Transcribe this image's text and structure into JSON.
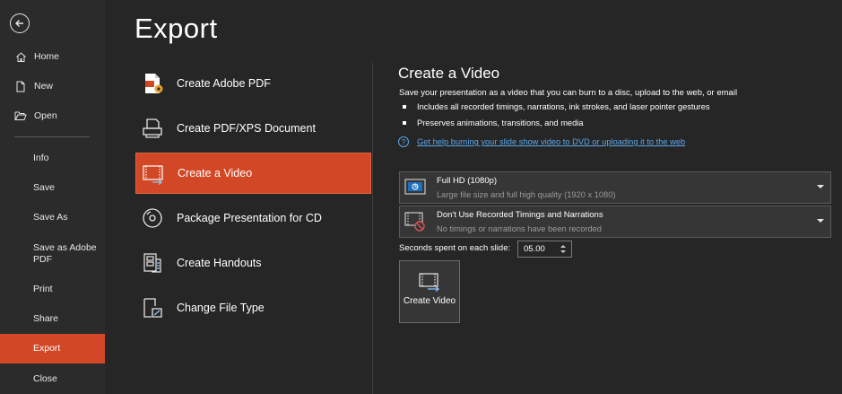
{
  "sidebar": {
    "items": [
      {
        "label": "Home",
        "icon": "home-icon"
      },
      {
        "label": "New",
        "icon": "new-doc-icon"
      },
      {
        "label": "Open",
        "icon": "folder-open-icon"
      },
      {
        "label": "Info"
      },
      {
        "label": "Save"
      },
      {
        "label": "Save As"
      },
      {
        "label": "Save as Adobe PDF"
      },
      {
        "label": "Print"
      },
      {
        "label": "Share"
      },
      {
        "label": "Export",
        "active": true
      },
      {
        "label": "Close"
      }
    ]
  },
  "page": {
    "title": "Export"
  },
  "export_options": [
    {
      "label": "Create Adobe PDF",
      "icon": "adobe-pdf-icon"
    },
    {
      "label": "Create PDF/XPS Document",
      "icon": "pdf-xps-icon"
    },
    {
      "label": "Create a Video",
      "icon": "video-icon",
      "selected": true
    },
    {
      "label": "Package Presentation for CD",
      "icon": "cd-icon"
    },
    {
      "label": "Create Handouts",
      "icon": "handouts-icon"
    },
    {
      "label": "Change File Type",
      "icon": "change-file-type-icon"
    }
  ],
  "pane": {
    "title": "Create a Video",
    "description": "Save your presentation as a video that you can burn to a disc, upload to the web, or email",
    "bullets": [
      "Includes all recorded timings, narrations, ink strokes, and laser pointer gestures",
      "Preserves animations, transitions, and media"
    ],
    "help_link": "Get help burning your slide show video to DVD or uploading it to the web",
    "quality": {
      "main": "Full HD (1080p)",
      "sub": "Large file size and full high quality (1920 x 1080)"
    },
    "timings": {
      "main": "Don't Use Recorded Timings and Narrations",
      "sub": "No timings or narrations have been recorded"
    },
    "seconds_label": "Seconds spent on each slide:",
    "seconds_value": "05.00",
    "create_button": "Create Video"
  },
  "colors": {
    "accent": "#d24726",
    "link": "#5aa7ea",
    "background": "#262626",
    "sidebar": "#2b2b2b"
  }
}
